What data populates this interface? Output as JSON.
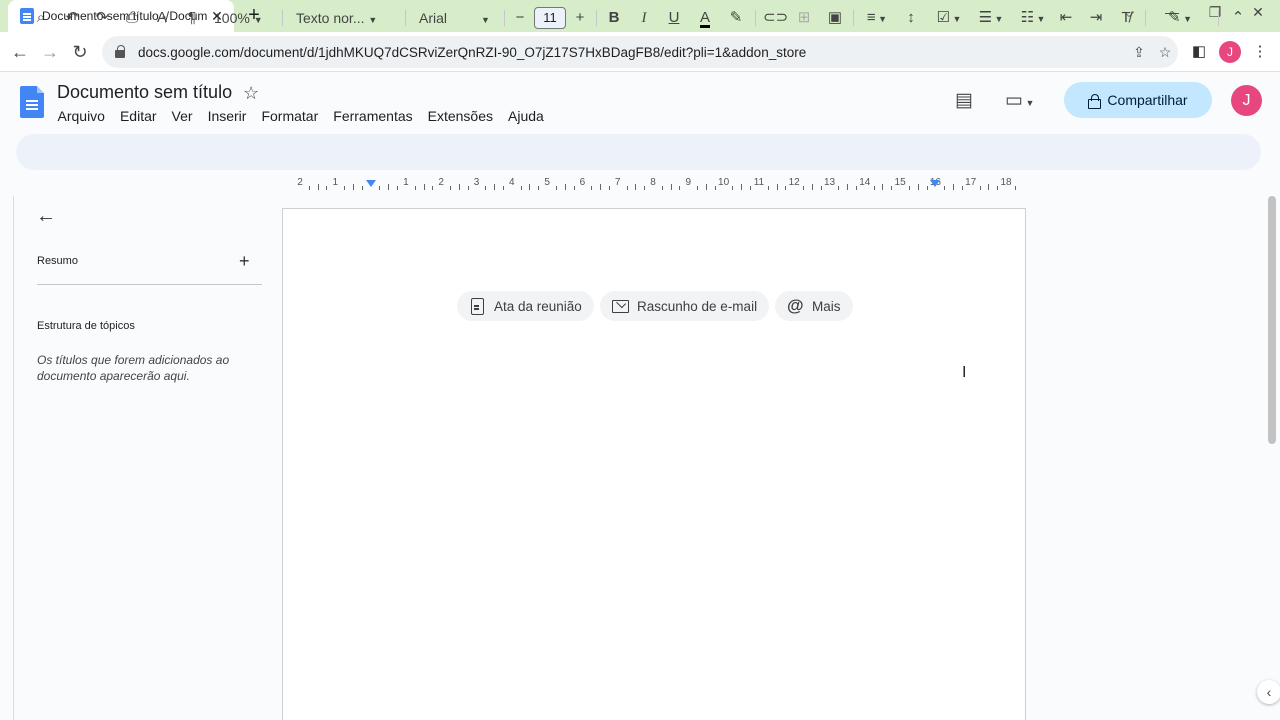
{
  "browser": {
    "tab_title": "Documento sem título - Docum",
    "tab_close": "✕",
    "new_tab": "+",
    "url": "docs.google.com/document/d/1jdhMKUQ7dCSRviZerQnRZI-90_O7jZ17S7HxBDagFB8/edit?pli=1&addon_store",
    "profile_initial": "J",
    "window_minimize": "⌵",
    "window_min": "—",
    "window_restore": "❐",
    "window_close": "✕"
  },
  "doc": {
    "title": "Documento sem título",
    "menu": [
      "Arquivo",
      "Editar",
      "Ver",
      "Inserir",
      "Formatar",
      "Ferramentas",
      "Extensões",
      "Ajuda"
    ],
    "share_label": "Compartilhar",
    "user_initial": "J"
  },
  "format_toolbar": {
    "zoom": "100%",
    "style": "Texto nor...",
    "font": "Arial",
    "font_size": "11"
  },
  "ruler": {
    "labels": [
      "2",
      "1",
      "",
      "1",
      "2",
      "3",
      "4",
      "5",
      "6",
      "7",
      "8",
      "9",
      "10",
      "11",
      "12",
      "13",
      "14",
      "15",
      "16",
      "17",
      "18"
    ]
  },
  "sidebar": {
    "summary_label": "Resumo",
    "outline_label": "Estrutura de tópicos",
    "outline_hint": "Os títulos que forem adicionados ao documento aparecerão aqui."
  },
  "page": {
    "chips": [
      "Ata da reunião",
      "Rascunho de e-mail",
      "Mais"
    ]
  },
  "colors": {
    "accent": "#4285f4",
    "share_bg": "#c2e7ff",
    "avatar": "#e8467f",
    "tabstrip": "#d7ecc8"
  }
}
